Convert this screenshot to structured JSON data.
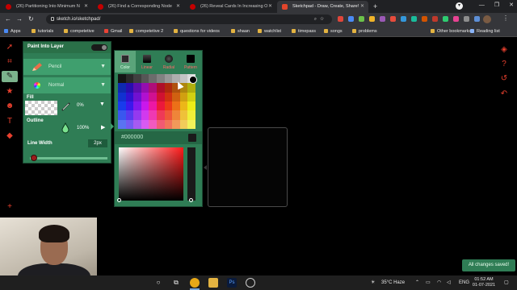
{
  "browser": {
    "tabs": [
      {
        "title": "(26) Partitioning Into Minimum N",
        "active": false
      },
      {
        "title": "(26) Find a Corresponding Node",
        "active": false
      },
      {
        "title": "(26) Reveal Cards In Increasing O",
        "active": false
      },
      {
        "title": "Sketchpad - Draw, Create, Share!",
        "active": true
      }
    ],
    "new_tab": "+",
    "url": "sketch.io/sketchpad/",
    "bookmarks": [
      {
        "label": "Apps",
        "icon": "apps-grid-icon"
      },
      {
        "label": "tutorials",
        "icon": "folder-icon"
      },
      {
        "label": "competetive",
        "icon": "folder-icon"
      },
      {
        "label": "Gmail",
        "icon": "gmail-icon"
      },
      {
        "label": "competetive 2",
        "icon": "folder-icon"
      },
      {
        "label": "questions for videos",
        "icon": "folder-icon"
      },
      {
        "label": "shaan",
        "icon": "folder-icon"
      },
      {
        "label": "watchlist",
        "icon": "folder-icon"
      },
      {
        "label": "timepass",
        "icon": "folder-icon"
      },
      {
        "label": "songs",
        "icon": "folder-icon"
      },
      {
        "label": "problems",
        "icon": "folder-icon"
      }
    ],
    "other_bookmarks": "Other bookmarks",
    "reading_list": "Reading list"
  },
  "brush_panel": {
    "title": "Paint Into Layer",
    "brush": "Pencil",
    "blend_mode": "Normal",
    "fill_label": "Fill",
    "fill_opacity": "0%",
    "outline_label": "Outline",
    "outline_opacity": "100%",
    "line_width_label": "Line Width",
    "line_width_value": "2px"
  },
  "color_picker": {
    "tabs": [
      "Color",
      "Linear",
      "Radial",
      "Pattern"
    ],
    "active_tab": "Color",
    "hex_value": "#000000"
  },
  "status": {
    "save_message": "All changes saved!"
  },
  "taskbar": {
    "weather": "35°C  Haze",
    "language": "ENG",
    "time": "01:52 AM",
    "date": "01-07-2021"
  },
  "colors": {
    "panel_green": "#2f7d55",
    "panel_row": "#3f9f6e",
    "tool_red": "#e8402e"
  }
}
